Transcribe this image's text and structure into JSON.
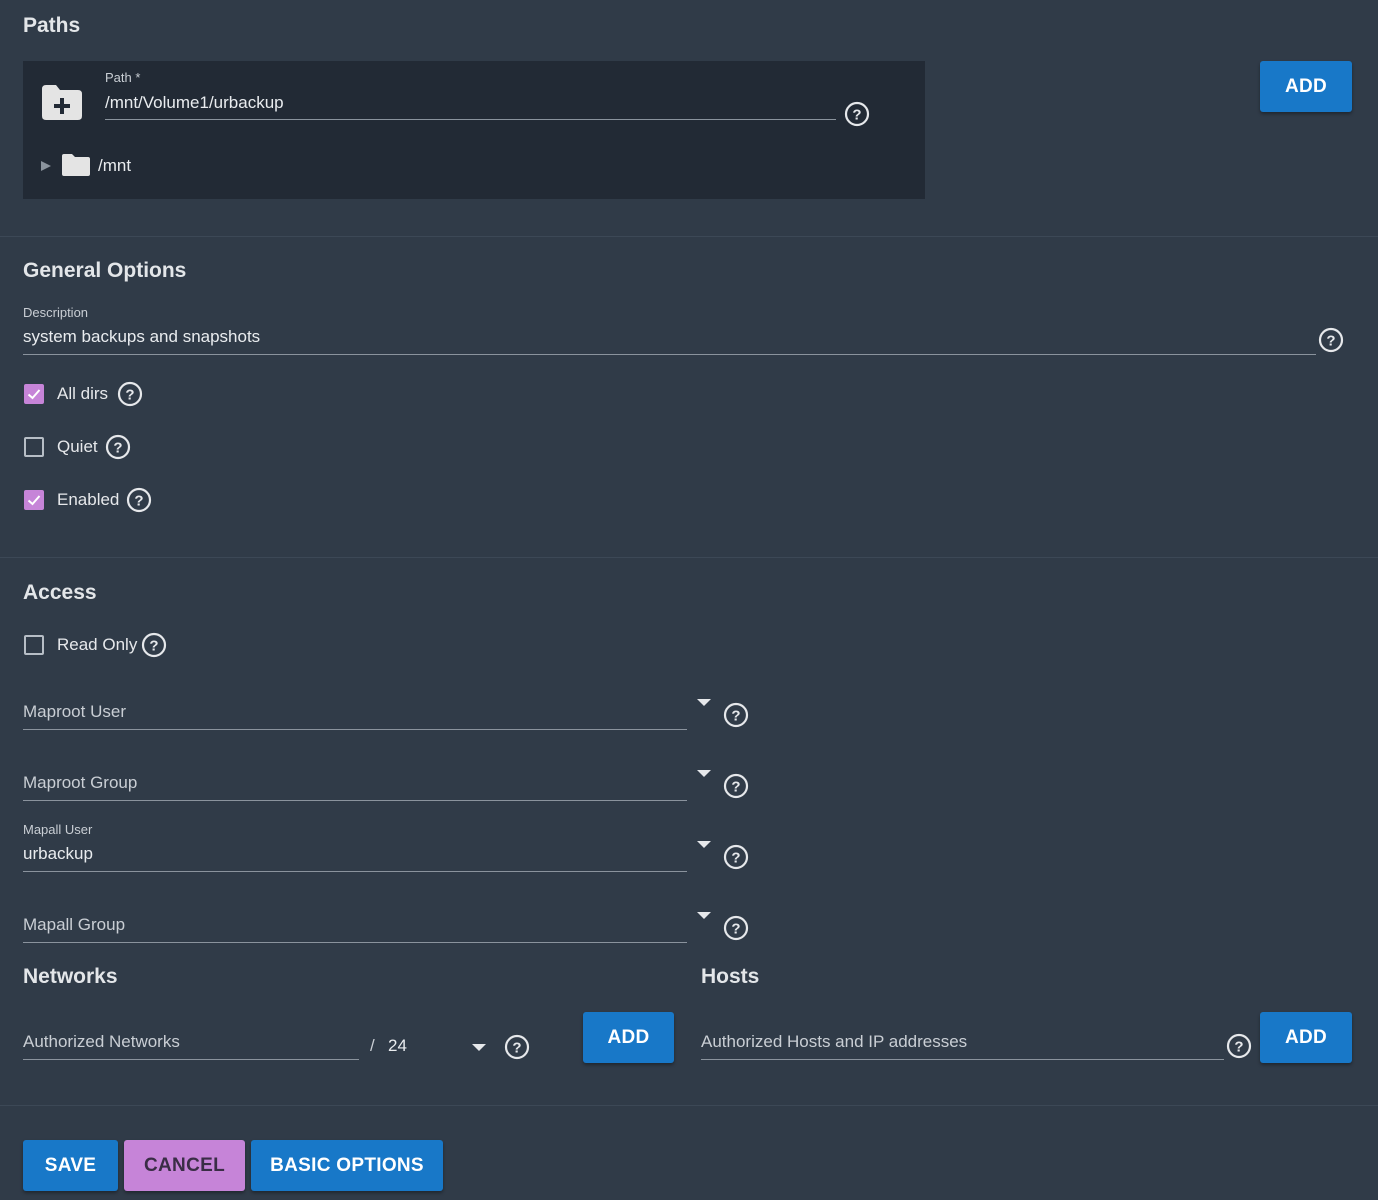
{
  "paths": {
    "title": "Paths",
    "path_label": "Path *",
    "path_value": "/mnt/Volume1/urbackup",
    "tree_root": "/mnt",
    "add_label": "ADD"
  },
  "general": {
    "title": "General Options",
    "description_label": "Description",
    "description_value": "system backups and snapshots",
    "checkboxes": [
      {
        "label": "All dirs",
        "checked": true
      },
      {
        "label": "Quiet",
        "checked": false
      },
      {
        "label": "Enabled",
        "checked": true
      }
    ]
  },
  "access": {
    "title": "Access",
    "read_only": {
      "label": "Read Only",
      "checked": false
    },
    "maproot_user": {
      "placeholder": "Maproot User",
      "value": ""
    },
    "maproot_group": {
      "placeholder": "Maproot Group",
      "value": ""
    },
    "mapall_user": {
      "label": "Mapall User",
      "value": "urbackup"
    },
    "mapall_group": {
      "placeholder": "Mapall Group",
      "value": ""
    }
  },
  "networks": {
    "title": "Networks",
    "placeholder": "Authorized Networks",
    "slash": "/",
    "mask": "24",
    "add_label": "ADD"
  },
  "hosts": {
    "title": "Hosts",
    "placeholder": "Authorized Hosts and IP addresses",
    "add_label": "ADD"
  },
  "footer": {
    "save_label": "SAVE",
    "cancel_label": "CANCEL",
    "basic_label": "BASIC OPTIONS"
  },
  "colors": {
    "background": "#303b48",
    "panel": "#222a35",
    "primary": "#1878c8",
    "accent": "#c684d8"
  }
}
